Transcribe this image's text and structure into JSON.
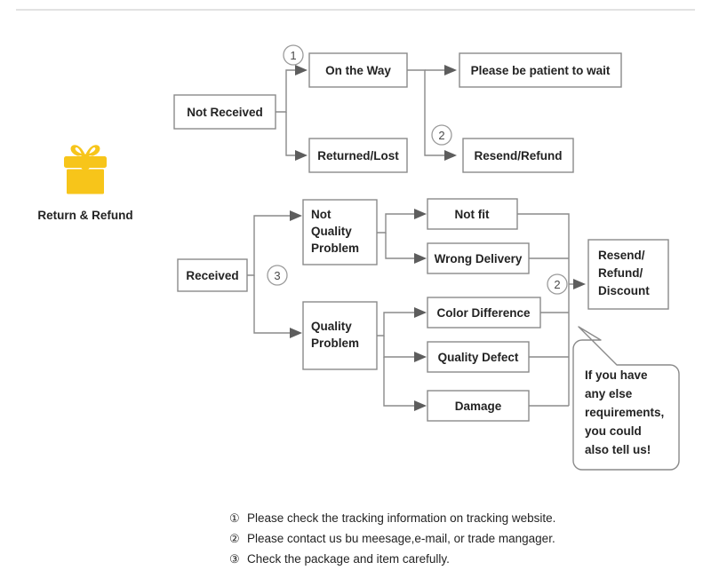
{
  "diagram": {
    "icon_label": "Return & Refund",
    "icon_name": "gift-box-icon",
    "icon_color": "#F7C51A",
    "line_color": "#8a8a8a",
    "text_color": "#232323"
  },
  "markers": {
    "one": "①",
    "two": "②",
    "three": "③",
    "one_plain": "1",
    "two_plain": "2",
    "three_plain": "3"
  },
  "branch_not_received": {
    "root": "Not Received",
    "stage1": [
      {
        "label": "On the Way"
      },
      {
        "label": "Returned/Lost"
      }
    ],
    "stage2": [
      {
        "label": "Please be patient to wait"
      },
      {
        "label": "Resend/Refund"
      }
    ]
  },
  "branch_received": {
    "root": "Received",
    "categories": [
      {
        "label_lines": [
          "Not",
          "Quality",
          "Problem"
        ]
      },
      {
        "label_lines": [
          "Quality",
          "Problem"
        ]
      }
    ],
    "reasons_not_quality": [
      {
        "label": "Not fit"
      },
      {
        "label": "Wrong Delivery"
      }
    ],
    "reasons_quality": [
      {
        "label": "Color Difference"
      },
      {
        "label": "Quality Defect"
      },
      {
        "label": "Damage"
      }
    ],
    "outcome": {
      "label_lines": [
        "Resend/",
        "Refund/",
        "Discount"
      ]
    }
  },
  "callout": {
    "lines": [
      "If you have",
      "any else",
      "requirements,",
      "you could",
      "also tell us!"
    ]
  },
  "notes": [
    {
      "num": "①",
      "text": "Please check the tracking information on tracking website."
    },
    {
      "num": "②",
      "text": "Please contact us bu meesage,e-mail, or trade mangager."
    },
    {
      "num": "③",
      "text": "Check the package and item carefully."
    }
  ]
}
